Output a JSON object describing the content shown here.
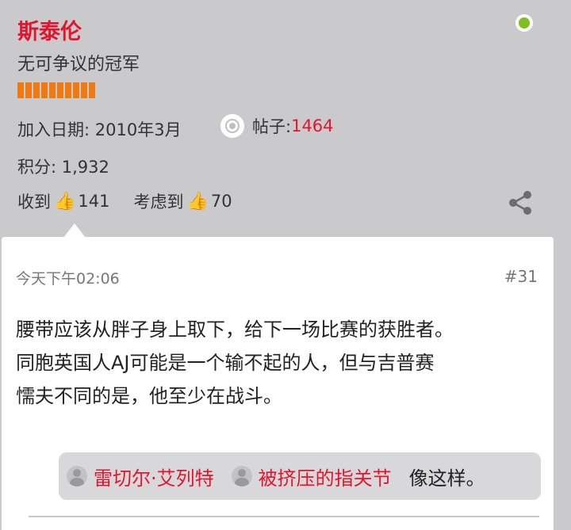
{
  "user": {
    "name": "斯泰伦",
    "title": "无可争议的冠军",
    "rank_segments": 10,
    "online_status_color": "#7fbf1e",
    "join_label": "加入日期:",
    "join_date": "2010年3月",
    "posts_label": "帖子:",
    "posts_count": "1464",
    "points_label": "积分:",
    "points_value": "1,932",
    "received_label": "收到",
    "received_count": "141",
    "considered_label": "考虑到",
    "considered_count": "70"
  },
  "icons": {
    "thumbs_up": "👍",
    "share": "share-icon"
  },
  "post": {
    "time": "今天下午02:06",
    "number": "#31",
    "body_lines": [
      "腰带应该从胖子身上取下，给下一场比赛的获胜者。",
      "同胞英国人AJ可能是一个输不起的人，但与吉普赛",
      "懦夫不同的是，他至少在战斗。"
    ],
    "reactions": {
      "users": [
        "雷切尔·艾列特",
        "被挤压的指关节"
      ],
      "suffix": "像这样。"
    }
  },
  "colors": {
    "accent_red": "#e3142d",
    "rank_orange": "#f07a12",
    "header_bg": "#cacacc"
  }
}
